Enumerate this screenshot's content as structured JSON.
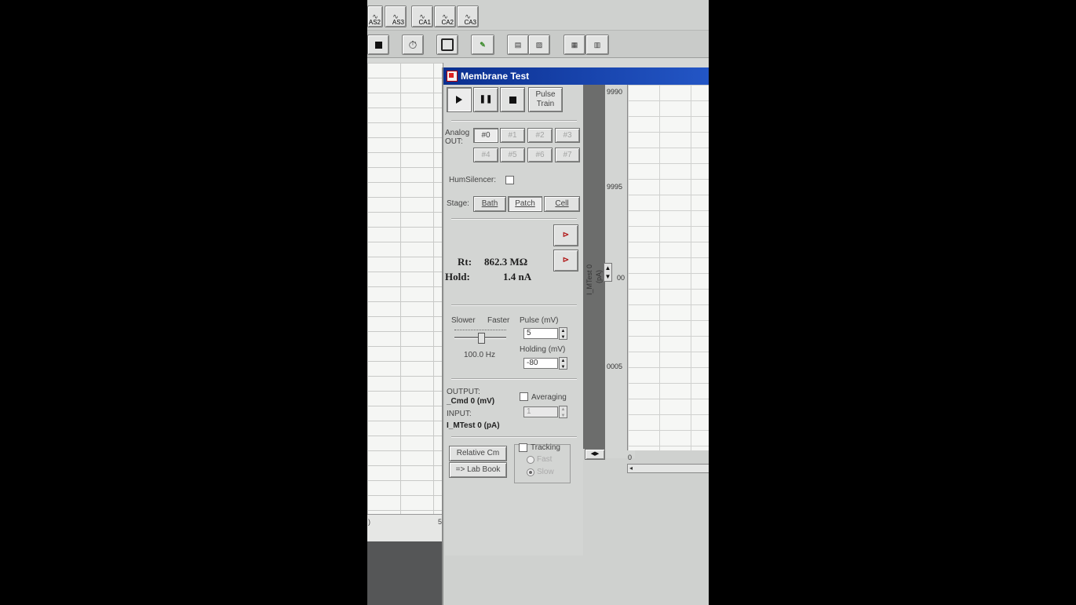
{
  "toolbar": {
    "top_labels": [
      "AS2",
      "AS3",
      "CA1",
      "CA2",
      "CA3"
    ]
  },
  "window": {
    "title": "Membrane Test"
  },
  "controls": {
    "pulse_train_line1": "Pulse",
    "pulse_train_line2": "Train"
  },
  "analog_out": {
    "label_line1": "Analog",
    "label_line2": "OUT:",
    "channels": [
      "#0",
      "#1",
      "#2",
      "#3",
      "#4",
      "#5",
      "#6",
      "#7"
    ]
  },
  "hum_silencer": {
    "label": "HumSilencer:",
    "checked": false
  },
  "stage": {
    "label": "Stage:",
    "buttons": [
      "Bath",
      "Patch",
      "Cell"
    ],
    "selected": "Patch"
  },
  "readout": {
    "rt_label": "Rt:",
    "rt_value": "862.3 MΩ",
    "hold_label": "Hold:",
    "hold_value": "1.4 nA"
  },
  "speed": {
    "slower": "Slower",
    "faster": "Faster",
    "rate": "100.0 Hz"
  },
  "pulse": {
    "label": "Pulse (mV)",
    "value": "5"
  },
  "holding": {
    "label": "Holding (mV)",
    "value": "-80"
  },
  "io": {
    "output_label": "OUTPUT:",
    "output_value": "_Cmd 0 (mV)",
    "input_label": "INPUT:",
    "input_value": "I_MTest 0 (pA)"
  },
  "averaging": {
    "label": "Averaging",
    "value": "1",
    "checked": false
  },
  "buttons": {
    "relative_cm": "Relative Cm",
    "lab_book": "=> Lab Book"
  },
  "tracking": {
    "label": "Tracking",
    "fast": "Fast",
    "slow": "Slow",
    "checked": false
  },
  "scope": {
    "y_ticks": [
      "9990",
      "9995",
      "00",
      "0005"
    ],
    "y_label": "I_MTest 0",
    "y_unit": "(pA)",
    "x_tick": "0"
  },
  "sheet": {
    "foot_left": ")",
    "foot_right": "5"
  }
}
